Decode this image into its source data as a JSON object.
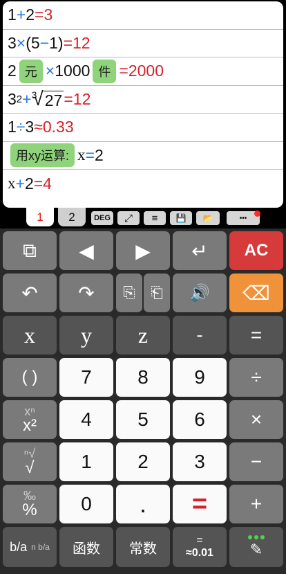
{
  "worksheet": {
    "l1": {
      "a": "1",
      "op": "+",
      "b": "2",
      "eq": "=",
      "r": "3"
    },
    "l2": {
      "a": "3",
      "op": "×",
      "p1": "(5",
      "op2": "−",
      "p2": "1)",
      "eq": "=",
      "r": "12"
    },
    "l3": {
      "a": "2",
      "tag1": "元",
      "op": "×",
      "b": "1000",
      "tag2": "件",
      "eq": "=",
      "r": "2000"
    },
    "l4": {
      "a": "3",
      "exp": "2",
      "op": "+",
      "rn": "3",
      "rs": "√",
      "rv": "27",
      "eq": "=",
      "r": "12"
    },
    "l5": {
      "a": "1",
      "op": "÷",
      "b": "3",
      "eq": "≈",
      "r": "0.33"
    },
    "l6": {
      "tag": "用xy运算:",
      "v": "x",
      "eq": "=",
      "r": "2"
    },
    "l7": {
      "v": "x",
      "op": "+",
      "b": "2",
      "eq": "=",
      "r": "4"
    }
  },
  "tabs": {
    "t1": "1",
    "t2": "2"
  },
  "toolbar": {
    "deg": "DEG",
    "expand": "⤢",
    "list": "≡",
    "save": "💾",
    "folder": "📂",
    "more": "•••"
  },
  "keys": {
    "r1": [
      "⧉",
      "◀",
      "▶",
      "↵",
      "AC"
    ],
    "r2": [
      "↶",
      "↷",
      "⎘",
      "⎗",
      "🔊",
      "⌫"
    ],
    "r3": [
      "x",
      "y",
      "z",
      "-",
      "="
    ],
    "r4": [
      "( )",
      "7",
      "8",
      "9",
      "÷"
    ],
    "r5": [
      "xⁿ",
      "x²",
      "4",
      "5",
      "6",
      "×"
    ],
    "r6": [
      "ⁿ√",
      "√",
      "1",
      "2",
      "3",
      "−"
    ],
    "r7": [
      "‰",
      "%",
      "0",
      ".",
      "=",
      "+"
    ],
    "r8": [
      "b/a",
      "n b/a",
      "函数",
      "常数",
      "=",
      "≈0.01",
      "✎"
    ]
  }
}
